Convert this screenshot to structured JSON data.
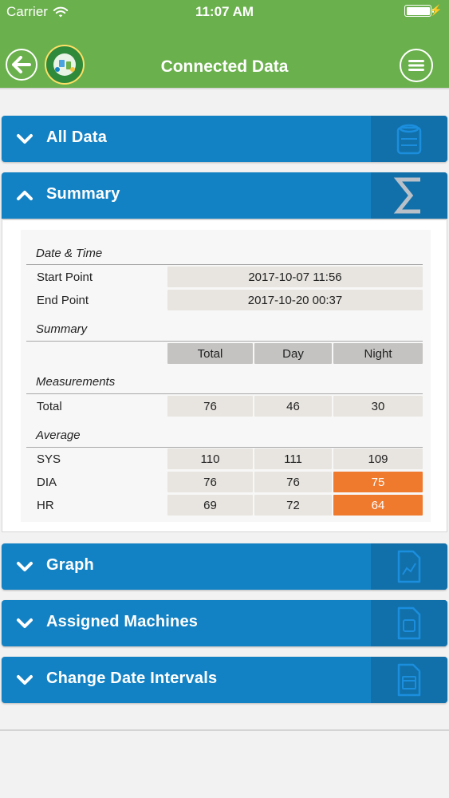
{
  "status_bar": {
    "carrier": "Carrier",
    "time": "11:07 AM"
  },
  "nav": {
    "title": "Connected Data"
  },
  "sections": {
    "all_data": "All Data",
    "summary": "Summary",
    "graph": "Graph",
    "assigned_machines": "Assigned Machines",
    "change_date_intervals": "Change Date Intervals"
  },
  "summary": {
    "date_time_title": "Date & Time",
    "start_label": "Start Point",
    "start_value": "2017-10-07 11:56",
    "end_label": "End Point",
    "end_value": "2017-10-20 00:37",
    "summary_title": "Summary",
    "columns": [
      "Total",
      "Day",
      "Night"
    ],
    "measurements_title": "Measurements",
    "total_label": "Total",
    "total_values": [
      "76",
      "46",
      "30"
    ],
    "average_title": "Average",
    "sys_label": "SYS",
    "sys_values": [
      "110",
      "111",
      "109"
    ],
    "dia_label": "DIA",
    "dia_values": [
      "76",
      "76",
      "75"
    ],
    "hr_label": "HR",
    "hr_values": [
      "69",
      "72",
      "64"
    ]
  },
  "colors": {
    "header_green": "#6ab04c",
    "section_blue": "#1382c4",
    "highlight_orange": "#ef7a2e"
  },
  "icons": {
    "back": "back-arrow-icon",
    "menu": "hamburger-menu-icon",
    "all_data": "database-icon",
    "summary": "sigma-icon",
    "graph": "chart-document-icon",
    "machines": "machine-document-icon",
    "dates": "calendar-document-icon"
  }
}
